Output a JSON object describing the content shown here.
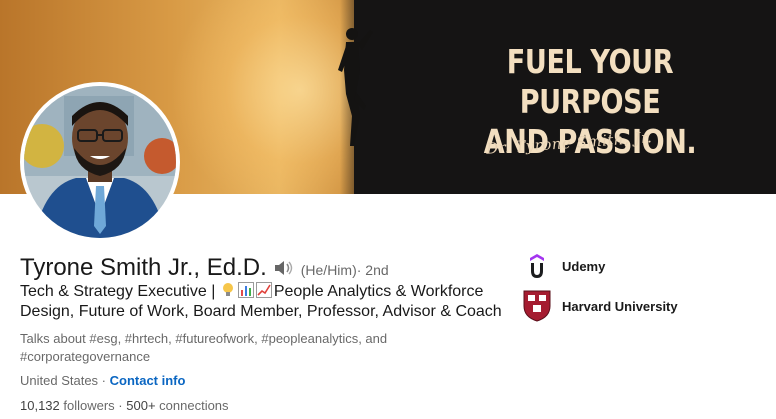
{
  "banner": {
    "headline_line1": "FUEL YOUR PURPOSE",
    "headline_line2": "AND PASSION.",
    "signature": "Dr. Tyrone Smith, Jr."
  },
  "profile": {
    "name": "Tyrone Smith Jr., Ed.D.",
    "pronouns": "(He/Him)",
    "degree": " · 2nd",
    "headline_prefix": "Tech & Strategy Executive |",
    "headline_rest": "People Analytics & Workforce Design, Future of Work, Board Member, Professor, Advisor & Coach",
    "talks_about": "Talks about #esg, #hrtech, #futureofwork, #peopleanalytics, and #corporategovernance",
    "location": "United States · ",
    "contact_label": "Contact info",
    "followers_count": "10,132",
    "followers_label": " followers",
    "separator": " · ",
    "connections_count": "500+",
    "connections_label": " connections"
  },
  "companies": [
    {
      "name": "Udemy",
      "icon": "udemy-logo"
    },
    {
      "name": "Harvard University",
      "icon": "harvard-shield-logo"
    }
  ],
  "icons": {
    "speaker": "speaker-icon",
    "emojis": [
      "lightbulb-emoji",
      "bar-chart-emoji",
      "chart-increasing-emoji"
    ]
  },
  "colors": {
    "link_blue": "#0a66c2",
    "udemy_purple": "#a435f0",
    "harvard_crimson": "#a51c30"
  }
}
